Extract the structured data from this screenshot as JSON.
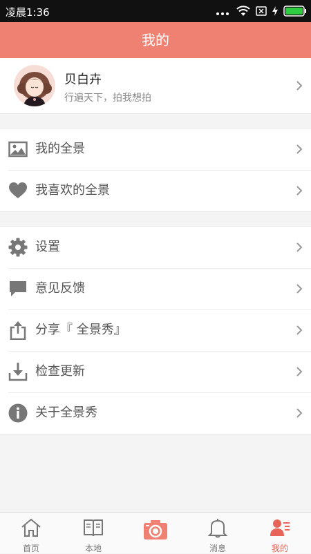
{
  "status_bar": {
    "time": "凌晨1:36",
    "battery_color": "#2ecc40"
  },
  "header": {
    "title": "我的",
    "accent": "#ef8172"
  },
  "profile": {
    "name": "贝白卉",
    "signature": "行遍天下，拍我想拍"
  },
  "groups": [
    [
      {
        "label": "我的全景",
        "icon": "image-icon"
      },
      {
        "label": "我喜欢的全景",
        "icon": "heart-icon"
      }
    ],
    [
      {
        "label": "设置",
        "icon": "gear-icon"
      },
      {
        "label": "意见反馈",
        "icon": "chat-icon"
      },
      {
        "label": "分享『 全景秀』",
        "icon": "share-icon"
      },
      {
        "label": "检查更新",
        "icon": "download-icon"
      },
      {
        "label": "关于全景秀",
        "icon": "info-icon"
      }
    ]
  ],
  "tabs": [
    {
      "label": "首页",
      "icon": "home-icon"
    },
    {
      "label": "本地",
      "icon": "book-icon"
    },
    {
      "label": "",
      "icon": "camera-icon"
    },
    {
      "label": "消息",
      "icon": "bell-icon"
    },
    {
      "label": "我的",
      "icon": "profile-icon",
      "active": true
    }
  ]
}
